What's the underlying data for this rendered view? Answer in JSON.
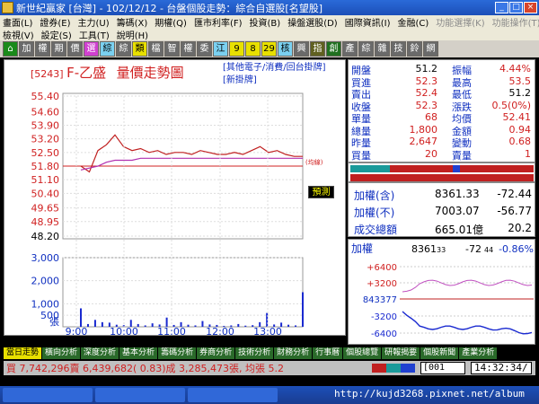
{
  "window": {
    "title": "新世紀贏家 [台灣] - 102/12/12 - 台盤個股走勢：綜合自選股[名望股]",
    "buttons": [
      "_",
      "□",
      "×"
    ]
  },
  "menu": {
    "row1": [
      "畫面(L)",
      "證券(E)",
      "主力(U)",
      "籌碼(X)",
      "期權(Q)",
      "匯市利率(F)",
      "投資(B)",
      "操盤選股(D)",
      "國際資訊(I)",
      "金融(C)",
      "功能選擇(K)",
      "功能操作(T)"
    ],
    "row2": [
      "檢視(V)",
      "設定(S)",
      "工具(T)",
      "說明(H)"
    ]
  },
  "toolbar": {
    "buttons": [
      "⌂",
      "加",
      "權",
      "期",
      "價",
      "選",
      "綜",
      "綜",
      "類",
      "檔",
      "智",
      "權",
      "委",
      "江",
      "9",
      "8",
      "29",
      "核",
      "興",
      "指",
      "創",
      "產",
      "綜",
      "雜",
      "技",
      "鈴",
      "網"
    ]
  },
  "chart": {
    "code": "[5243]",
    "name": "F-乙盛",
    "title": "量價走勢圖",
    "links": [
      "[其他電子/消費/回台掛牌]",
      "[新掛牌]"
    ],
    "predict_label": "預測",
    "ref_label": "(均線)",
    "vol_unit": "張"
  },
  "chart_data": {
    "type": "line",
    "price_ticks": [
      "55.40",
      "54.60",
      "53.90",
      "53.20",
      "52.50",
      "51.80",
      "51.10",
      "50.40",
      "49.65",
      "48.95",
      "48.20"
    ],
    "volume_ticks": [
      "3,000",
      "2,000",
      "1,000",
      "500"
    ],
    "time_ticks": [
      "9:00",
      "10:00",
      "11:00",
      "12:00",
      "13:00"
    ],
    "ylim": [
      48.2,
      55.4
    ],
    "reference_price": 51.8,
    "series": [
      {
        "values": [
          51.8,
          51.5,
          52.6,
          52.9,
          53.4,
          52.8,
          52.6,
          52.7,
          52.5,
          52.6,
          52.4,
          52.5,
          52.5,
          52.4,
          52.6,
          52.5,
          52.4,
          52.4,
          52.5,
          52.4,
          52.6,
          52.8,
          52.5,
          52.6,
          52.4,
          52.3,
          52.3
        ]
      },
      {
        "values": [
          51.6,
          51.7,
          51.8,
          52.0,
          52.1,
          52.1,
          52.1,
          52.2,
          52.2,
          52.2,
          52.2,
          52.2,
          52.2,
          52.2,
          52.2,
          52.2,
          52.2,
          52.2,
          52.2,
          52.2,
          52.2,
          52.2,
          52.2,
          52.2,
          52.2,
          52.2,
          52.2
        ]
      }
    ],
    "volumes": [
      800,
      120,
      300,
      200,
      180,
      90,
      70,
      300,
      120,
      60,
      150,
      100,
      400,
      80,
      200,
      90,
      60,
      250,
      100,
      80,
      40,
      60,
      120,
      50,
      70,
      200,
      600,
      100,
      180,
      90,
      60,
      1500
    ]
  },
  "quote": {
    "rows": [
      {
        "l1": "開盤",
        "v1": "51.2",
        "c1": "blk",
        "l2": "振幅",
        "v2": "4.44%",
        "c2": "red"
      },
      {
        "l1": "買進",
        "v1": "52.3",
        "c1": "red",
        "l2": "最高",
        "v2": "53.5",
        "c2": "red"
      },
      {
        "l1": "賣出",
        "v1": "52.4",
        "c1": "red",
        "l2": "最低",
        "v2": "51.2",
        "c2": "blk"
      },
      {
        "l1": "收盤",
        "v1": "52.3",
        "c1": "red",
        "l2": "漲跌",
        "v2": "0.5(0%)",
        "c2": "red"
      },
      {
        "l1": "單量",
        "v1": "68",
        "c1": "red",
        "l2": "均價",
        "v2": "52.41",
        "c2": "red"
      },
      {
        "l1": "總量",
        "v1": "1,800",
        "c1": "red",
        "l2": "金額",
        "v2": "0.94",
        "c2": "red"
      },
      {
        "l1": "昨量",
        "v1": "2,647",
        "c1": "red",
        "l2": "變動",
        "v2": "0.68",
        "c2": "red"
      },
      {
        "l1": "買量",
        "v1": "20",
        "c1": "red",
        "l2": "賣量",
        "v2": "1",
        "c2": "red"
      }
    ]
  },
  "index": {
    "rows": [
      {
        "label": "加權(含)",
        "v1": "8361.33",
        "v2": "-72.44"
      },
      {
        "label": "加權(不)",
        "v1": "7003.07",
        "v2": "-56.77"
      },
      {
        "label": "成交總額",
        "v1": "665.01億",
        "v2": "20.2"
      }
    ]
  },
  "mini": {
    "label": "加權",
    "value": "8361",
    "value_small": "33",
    "change": "-72",
    "change_small": "44",
    "pct": "-0.86%",
    "ticks": [
      "+6400",
      "+3200",
      "843377",
      "-3200",
      "-6400"
    ]
  },
  "tabs": [
    "當日走勢",
    "橫向分析",
    "深度分析",
    "基本分析",
    "籌碼分析",
    "券商分析",
    "技術分析",
    "財務分析",
    "行事曆",
    "個股總覽",
    "研報揭要",
    "個股新聞",
    "產業分析"
  ],
  "status": {
    "text": "買 7,742,296賣 6,439,682( 0.83)成 3,285,473張, 均張 5.2",
    "code": "[001",
    "time": "14:32:34/"
  },
  "taskbar": {
    "tasks": [
      "",
      "",
      ""
    ],
    "watermark": "http://kujd3268.pixnet.net/album"
  },
  "colors": {
    "price": "#c02020",
    "avg": "#b030b0",
    "volume": "#1a2ad0",
    "up": "#d02020"
  }
}
